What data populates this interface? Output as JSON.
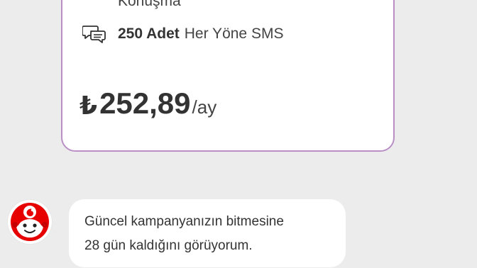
{
  "plan_card": {
    "cut_off_text": "Konuşma",
    "sms": {
      "icon": "chat-bubbles-icon",
      "amount_label": "250 Adet",
      "description": "Her Yöne SMS"
    },
    "price": {
      "currency_symbol": "₺",
      "amount": "252,89",
      "period": "/ay"
    },
    "border_color": "#b98fc5"
  },
  "chat": {
    "assistant_avatar_icon": "vodafone-assistant-avatar",
    "message_lines": [
      "Güncel kampanyanızın bitmesine",
      "28 gün kaldığını görüyorum."
    ]
  },
  "colors": {
    "background": "#ececec",
    "brand_red": "#e60000"
  }
}
